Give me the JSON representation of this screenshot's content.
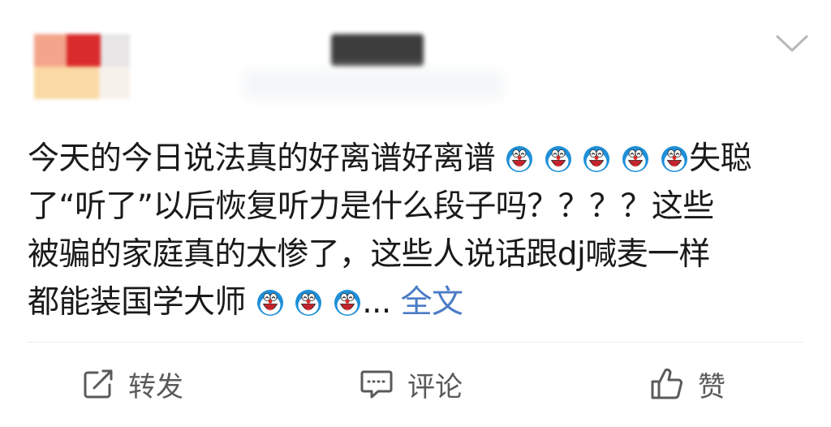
{
  "post": {
    "lines": [
      [
        "今天的今日说法真的好离谱好离谱",
        "E",
        "E",
        "E",
        "E",
        "E",
        "失聪"
      ],
      [
        "了“听了”以后恢复听力是什么段子吗？？？？这些"
      ],
      [
        "被骗的家庭真的太惨了，这些人说话跟dj喊麦一样"
      ],
      [
        "都能装国学大师",
        "E",
        "E",
        "E"
      ]
    ],
    "ellipsis": "...",
    "full_text_link": "全文"
  },
  "emoji_icon": "doraemon-laughing-emoji",
  "actions": {
    "repost_label": "转发",
    "comment_label": "评论",
    "like_label": "赞"
  },
  "colors": {
    "link": "#4b7bc6",
    "text": "#1a1a1a",
    "action": "#5a5a5a"
  }
}
